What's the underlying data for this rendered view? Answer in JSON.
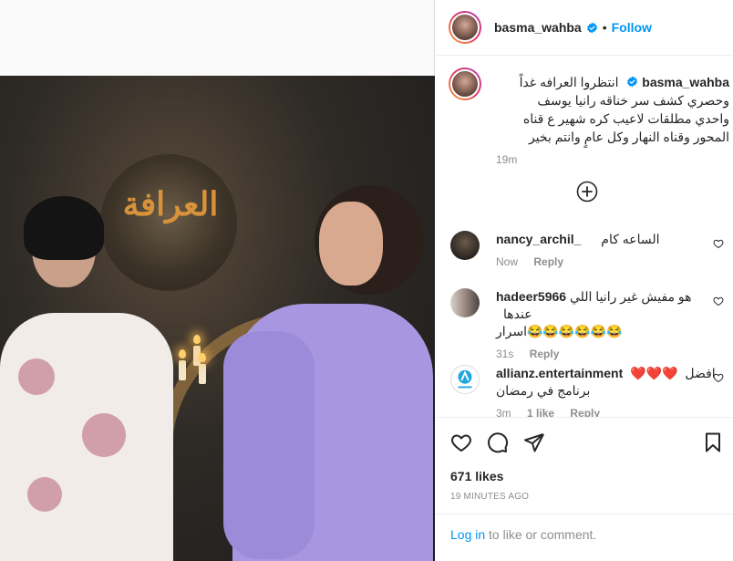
{
  "post": {
    "username": "basma_wahba",
    "follow_label": "Follow",
    "dot": "•",
    "more": "..."
  },
  "photo": {
    "logo_text": "العرافة"
  },
  "caption": {
    "username": "basma_wahba",
    "text_line1": "انتظروا العرافه غداً",
    "text_line2": "وحصري كشف سر خناقه رانيا يوسف",
    "text_line3": "واحدي مطلقات لاعيب كره شهير ع قناه",
    "text_line4": "المحور وقناه النهار وكل عامٍ وانتم بخير",
    "time": "19m"
  },
  "comments": [
    {
      "username": "nancy_archil_",
      "text": "الساعه كام",
      "time": "Now",
      "reply": "Reply"
    },
    {
      "username": "hadeer5966",
      "text_line1": "هو مفيش غير رانيا اللي عندها",
      "text_line2": "😂😂😂😂😂😂اسرار",
      "time": "31s",
      "reply": "Reply"
    },
    {
      "username": "allianz.entertainment",
      "hearts": "❤️❤️❤️",
      "text_line1": "افضل",
      "text_line2": "برنامج في رمضان",
      "time": "3m",
      "likes": "1 like",
      "reply": "Reply"
    }
  ],
  "actions": {
    "likes": "671 likes",
    "timestamp": "19 MINUTES AGO"
  },
  "login": {
    "link": "Log in",
    "rest": "to like or comment."
  },
  "colors": {
    "accent": "#0095f6",
    "meta": "#8e8e8e",
    "text": "#262626",
    "heart": "#ed4956"
  }
}
